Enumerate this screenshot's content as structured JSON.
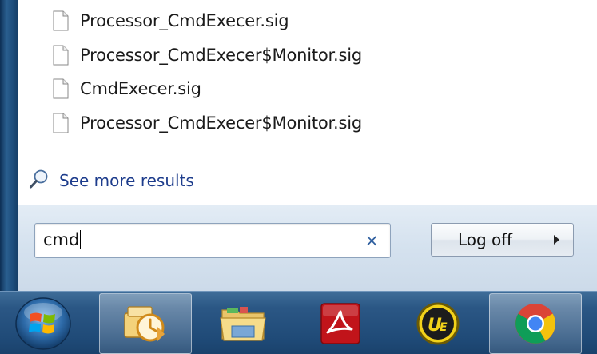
{
  "search_results": {
    "files": [
      {
        "name": "Processor_CmdExecer.sig"
      },
      {
        "name": "Processor_CmdExecer$Monitor.sig"
      },
      {
        "name": "CmdExecer.sig"
      },
      {
        "name": "Processor_CmdExecer$Monitor.sig"
      }
    ],
    "see_more_label": "See more results"
  },
  "search_box": {
    "value": "cmd",
    "clear_glyph": "×"
  },
  "power": {
    "logoff_label": "Log off"
  },
  "taskbar": {
    "items": [
      {
        "icon": "windows-start-orb"
      },
      {
        "icon": "outlook-tasks-icon",
        "active": true
      },
      {
        "icon": "file-explorer-icon"
      },
      {
        "icon": "acrobat-icon"
      },
      {
        "icon": "ultraedit-icon"
      },
      {
        "icon": "chrome-icon",
        "active": true
      }
    ]
  },
  "colors": {
    "link": "#1d3c8c",
    "taskbar": "#1f4a77",
    "clear_x": "#2f5f9f"
  }
}
